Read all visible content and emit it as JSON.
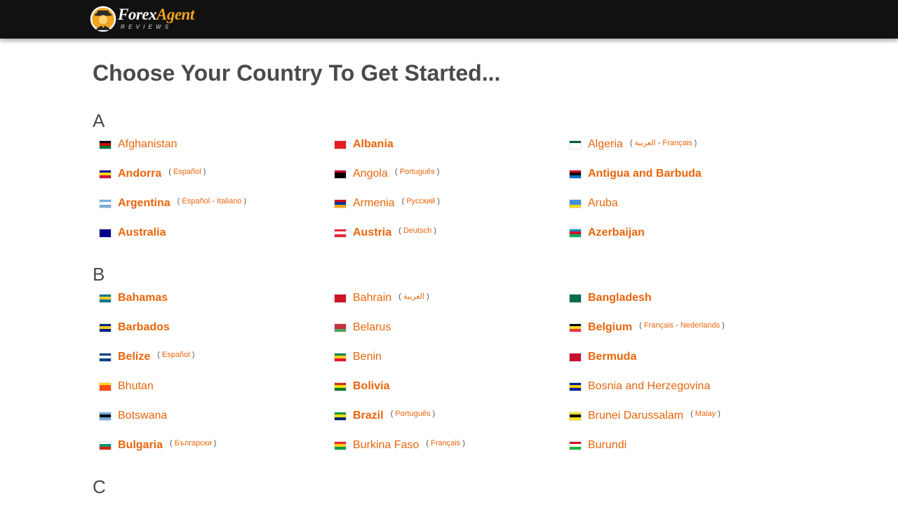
{
  "header": {
    "logo_word1": "Forex",
    "logo_word2": "Agent",
    "logo_sub": "REVIEWS"
  },
  "page": {
    "title": "Choose Your Country To Get Started..."
  },
  "sections": [
    {
      "letter": "A",
      "rows": [
        [
          {
            "name": "Afghanistan",
            "bold": false,
            "flag": [
              "#000",
              "#c00",
              "#007a36"
            ],
            "langs": []
          },
          {
            "name": "Albania",
            "bold": true,
            "flag": [
              "#e41e20",
              "#e41e20",
              "#e41e20"
            ],
            "langs": []
          },
          {
            "name": "Algeria",
            "bold": false,
            "flag": [
              "#006233",
              "#ffffff",
              "#ffffff"
            ],
            "langs": [
              "العربية",
              "Français"
            ]
          }
        ],
        [
          {
            "name": "Andorra",
            "bold": true,
            "flag": [
              "#10069f",
              "#fedf00",
              "#d50032"
            ],
            "langs": [
              "Español"
            ]
          },
          {
            "name": "Angola",
            "bold": false,
            "flag": [
              "#cc092f",
              "#000000",
              "#000000"
            ],
            "langs": [
              "Português"
            ]
          },
          {
            "name": "Antigua and Barbuda",
            "bold": true,
            "flag": [
              "#ce1126",
              "#000000",
              "#0072c6"
            ],
            "langs": []
          }
        ],
        [
          {
            "name": "Argentina",
            "bold": true,
            "flag": [
              "#74acdf",
              "#ffffff",
              "#74acdf"
            ],
            "langs": [
              "Español",
              "Italiano"
            ]
          },
          {
            "name": "Armenia",
            "bold": false,
            "flag": [
              "#d90012",
              "#0033a0",
              "#f2a800"
            ],
            "langs": [
              "Русский"
            ]
          },
          {
            "name": "Aruba",
            "bold": false,
            "flag": [
              "#418fde",
              "#418fde",
              "#f9d616"
            ],
            "langs": []
          }
        ],
        [
          {
            "name": "Australia",
            "bold": true,
            "flag": [
              "#00008b",
              "#00008b",
              "#00008b"
            ],
            "langs": []
          },
          {
            "name": "Austria",
            "bold": true,
            "flag": [
              "#ed2939",
              "#ffffff",
              "#ed2939"
            ],
            "langs": [
              "Deutsch"
            ]
          },
          {
            "name": "Azerbaijan",
            "bold": true,
            "flag": [
              "#0092bc",
              "#e4002b",
              "#00af66"
            ],
            "langs": []
          }
        ]
      ]
    },
    {
      "letter": "B",
      "rows": [
        [
          {
            "name": "Bahamas",
            "bold": true,
            "flag": [
              "#00778b",
              "#ffc72c",
              "#00778b"
            ],
            "langs": []
          },
          {
            "name": "Bahrain",
            "bold": false,
            "flag": [
              "#ce1126",
              "#ce1126",
              "#ce1126"
            ],
            "langs": [
              "العربية"
            ]
          },
          {
            "name": "Bangladesh",
            "bold": true,
            "flag": [
              "#006a4e",
              "#006a4e",
              "#006a4e"
            ],
            "langs": []
          }
        ],
        [
          {
            "name": "Barbados",
            "bold": true,
            "flag": [
              "#00267f",
              "#ffc726",
              "#00267f"
            ],
            "langs": []
          },
          {
            "name": "Belarus",
            "bold": false,
            "flag": [
              "#c8313e",
              "#c8313e",
              "#4aa657"
            ],
            "langs": []
          },
          {
            "name": "Belgium",
            "bold": true,
            "flag": [
              "#000000",
              "#fdda24",
              "#ef3340"
            ],
            "langs": [
              "Français",
              "Nederlands"
            ]
          }
        ],
        [
          {
            "name": "Belize",
            "bold": true,
            "flag": [
              "#003f87",
              "#ffffff",
              "#003f87"
            ],
            "langs": [
              "Español"
            ]
          },
          {
            "name": "Benin",
            "bold": false,
            "flag": [
              "#008751",
              "#fcd116",
              "#e8112d"
            ],
            "langs": []
          },
          {
            "name": "Bermuda",
            "bold": true,
            "flag": [
              "#c8102e",
              "#c8102e",
              "#c8102e"
            ],
            "langs": []
          }
        ],
        [
          {
            "name": "Bhutan",
            "bold": false,
            "flag": [
              "#ffd520",
              "#ff4e12",
              "#ff4e12"
            ],
            "langs": []
          },
          {
            "name": "Bolivia",
            "bold": true,
            "flag": [
              "#d52b1e",
              "#f9e300",
              "#007934"
            ],
            "langs": []
          },
          {
            "name": "Bosnia and Herzegovina",
            "bold": false,
            "flag": [
              "#002395",
              "#fecb00",
              "#002395"
            ],
            "langs": []
          }
        ],
        [
          {
            "name": "Botswana",
            "bold": false,
            "flag": [
              "#75aadb",
              "#000000",
              "#75aadb"
            ],
            "langs": []
          },
          {
            "name": "Brazil",
            "bold": true,
            "flag": [
              "#009c3b",
              "#ffdf00",
              "#002776"
            ],
            "langs": [
              "Português"
            ]
          },
          {
            "name": "Brunei Darussalam",
            "bold": false,
            "flag": [
              "#f7e017",
              "#000000",
              "#f7e017"
            ],
            "langs": [
              "Malay"
            ]
          }
        ],
        [
          {
            "name": "Bulgaria",
            "bold": true,
            "flag": [
              "#ffffff",
              "#00966e",
              "#d62612"
            ],
            "langs": [
              "Български"
            ]
          },
          {
            "name": "Burkina Faso",
            "bold": false,
            "flag": [
              "#ef2b2d",
              "#fcd116",
              "#009e49"
            ],
            "langs": [
              "Français"
            ]
          },
          {
            "name": "Burundi",
            "bold": false,
            "flag": [
              "#ce1126",
              "#ffffff",
              "#1eb53a"
            ],
            "langs": []
          }
        ]
      ]
    },
    {
      "letter": "C",
      "rows": []
    }
  ]
}
